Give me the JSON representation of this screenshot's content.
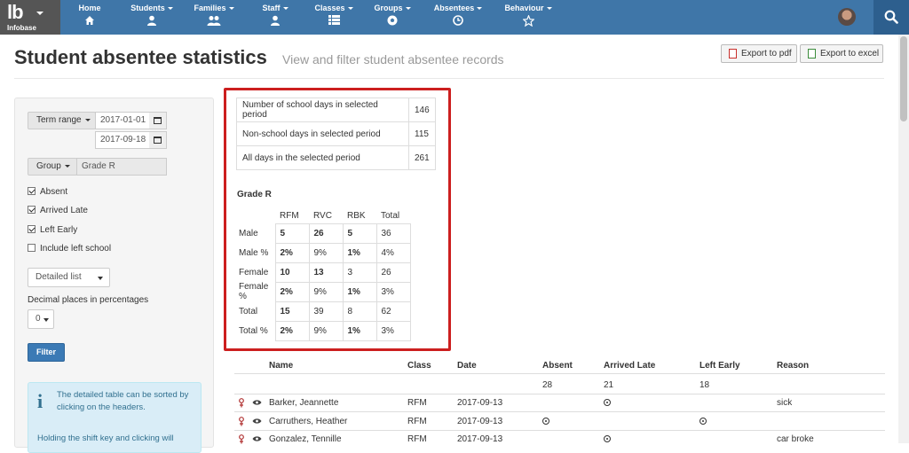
{
  "brand": {
    "logo": "lb",
    "subtitle": "Infobase"
  },
  "nav": {
    "items": [
      {
        "label": "Home",
        "icon": "home-icon",
        "dropdown": false
      },
      {
        "label": "Students",
        "icon": "user-icon",
        "dropdown": true
      },
      {
        "label": "Families",
        "icon": "family-icon",
        "dropdown": true
      },
      {
        "label": "Staff",
        "icon": "user-icon",
        "dropdown": true
      },
      {
        "label": "Classes",
        "icon": "list-icon",
        "dropdown": true
      },
      {
        "label": "Groups",
        "icon": "soccer-ball-icon",
        "dropdown": true
      },
      {
        "label": "Absentees",
        "icon": "clock-icon",
        "dropdown": true
      },
      {
        "label": "Behaviour",
        "icon": "star-icon",
        "dropdown": true
      }
    ]
  },
  "header": {
    "title": "Student absentee statistics",
    "subtitle": "View and filter student absentee records",
    "export_pdf": "Export to pdf",
    "export_excel": "Export to excel"
  },
  "sidebar": {
    "term_range_label": "Term range",
    "date_from": "2017-01-01",
    "date_to": "2017-09-18",
    "group_label": "Group",
    "group_value": "Grade R",
    "checks": [
      {
        "label": "Absent",
        "checked": true
      },
      {
        "label": "Arrived Late",
        "checked": true
      },
      {
        "label": "Left Early",
        "checked": true
      },
      {
        "label": "Include left school",
        "checked": false
      }
    ],
    "view_select": "Detailed list",
    "decimal_label": "Decimal places in percentages",
    "decimal_value": "0",
    "filter_label": "Filter",
    "info_text_1": "The detailed table can be sorted by clicking on the headers.",
    "info_text_2": "Holding the shift key and clicking will"
  },
  "totals": [
    {
      "label": "Number of school days in selected period",
      "value": "146"
    },
    {
      "label": "Non-school days in selected period",
      "value": "115"
    },
    {
      "label": "All days in the selected period",
      "value": "261"
    }
  ],
  "group_stats": {
    "title": "Grade R",
    "columns": [
      "RFM",
      "RVC",
      "RBK",
      "Total"
    ],
    "rows": [
      {
        "label": "Male",
        "values": [
          "5",
          "26",
          "5",
          "36"
        ]
      },
      {
        "label": "Male %",
        "values": [
          "2%",
          "9%",
          "1%",
          "4%"
        ]
      },
      {
        "label": "Female",
        "values": [
          "10",
          "13",
          "3",
          "26"
        ]
      },
      {
        "label": "Female %",
        "values": [
          "2%",
          "9%",
          "1%",
          "3%"
        ]
      },
      {
        "label": "Total",
        "values": [
          "15",
          "39",
          "8",
          "62"
        ]
      },
      {
        "label": "Total %",
        "values": [
          "2%",
          "9%",
          "1%",
          "3%"
        ]
      }
    ]
  },
  "detail": {
    "headers": {
      "name": "Name",
      "class": "Class",
      "date": "Date",
      "absent": "Absent",
      "late": "Arrived Late",
      "early": "Left Early",
      "reason": "Reason"
    },
    "counts": {
      "absent": "28",
      "late": "21",
      "early": "18"
    },
    "rows": [
      {
        "name": "Barker, Jeannette",
        "class": "RFM",
        "date": "2017-09-13",
        "absent": false,
        "late": true,
        "early": false,
        "reason": "sick"
      },
      {
        "name": "Carruthers, Heather",
        "class": "RFM",
        "date": "2017-09-13",
        "absent": true,
        "late": false,
        "early": true,
        "reason": ""
      },
      {
        "name": "Gonzalez, Tennille",
        "class": "RFM",
        "date": "2017-09-13",
        "absent": false,
        "late": true,
        "early": false,
        "reason": "car broke"
      }
    ]
  },
  "colors": {
    "nav": "#3f76a8",
    "brand": "#555555",
    "highlight": "#cc1f1f",
    "filter": "#3b7ab5",
    "info_bg": "#d9edf7"
  }
}
